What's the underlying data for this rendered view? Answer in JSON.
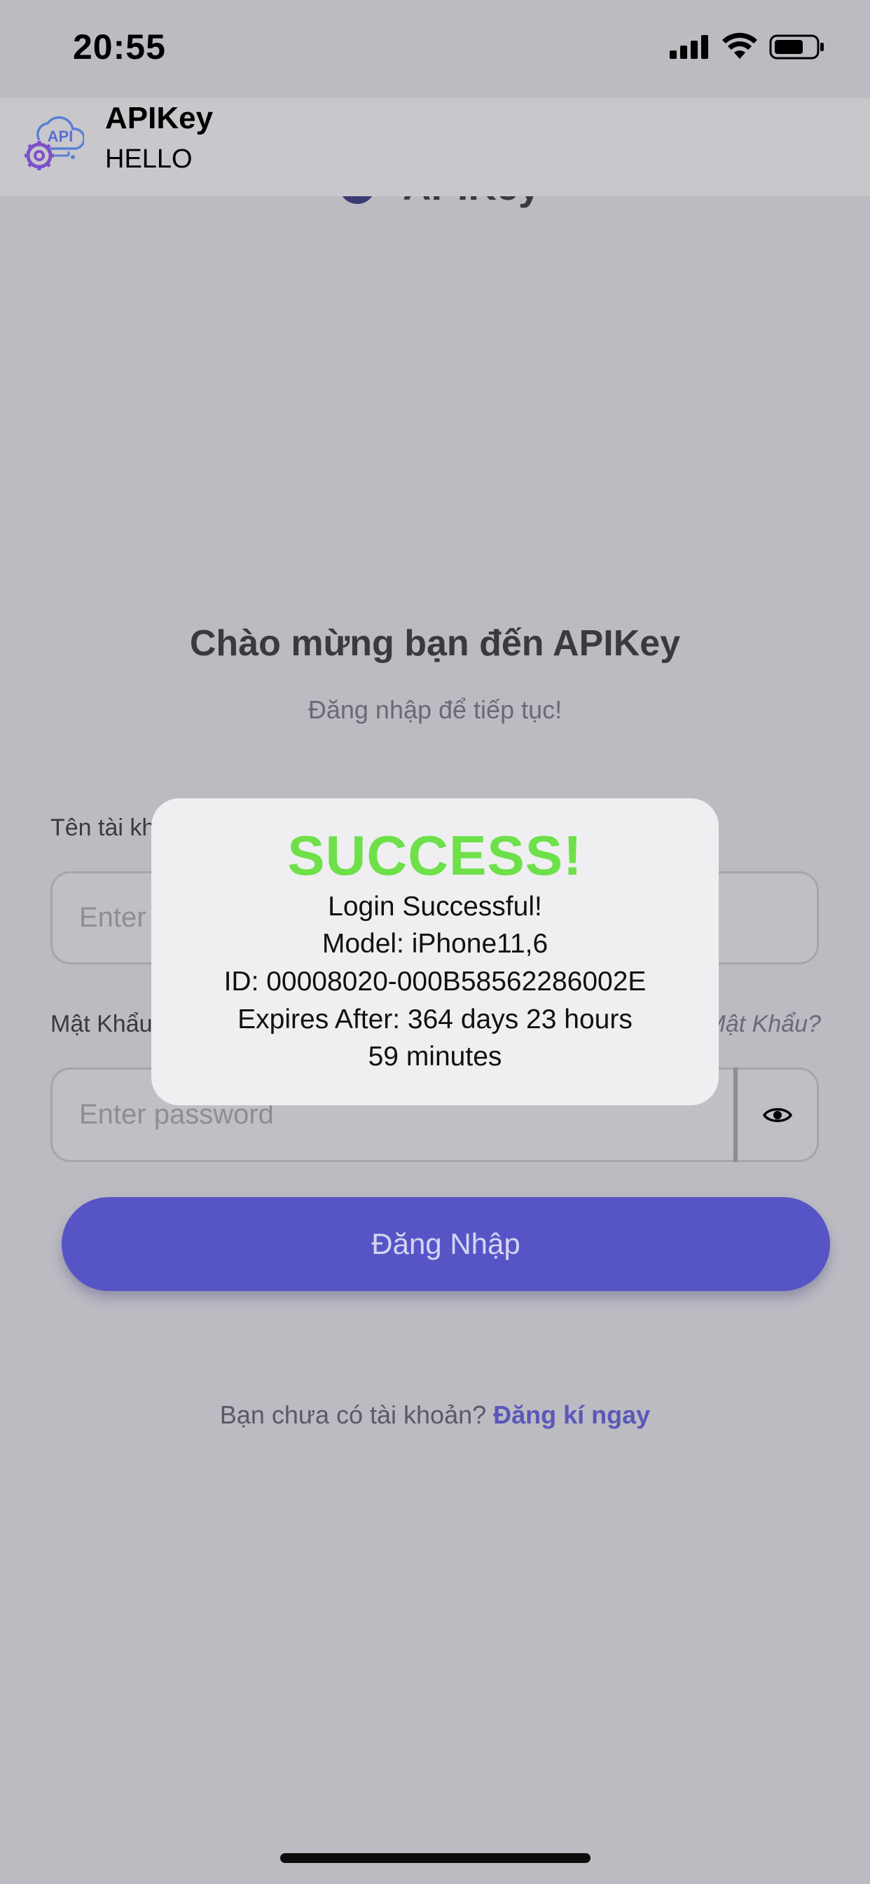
{
  "status_bar": {
    "time": "20:55"
  },
  "notification": {
    "app_name": "APIKey",
    "message": "HELLO",
    "icon_text": "API"
  },
  "login": {
    "welcome_title": "Chào mừng bạn đến APIKey",
    "subtitle": "Đăng nhập để tiếp tục!",
    "username_label": "Tên tài kh",
    "username_placeholder": "Enter",
    "password_label": "Mật Khẩu",
    "forgot_password": "Mật Khẩu?",
    "password_placeholder": "Enter password",
    "login_button": "Đăng Nhập",
    "signup_prompt": "Bạn chưa có tài khoản? ",
    "signup_link": "Đăng kí ngay"
  },
  "modal": {
    "title": "SUCCESS!",
    "line1": "Login Successful!",
    "line2": "Model: iPhone11,6",
    "line3": "ID: 00008020-000B58562286002E",
    "line4": "Expires After: 364 days 23 hours",
    "line5": "59 minutes",
    "title_color": "#6ee04a"
  },
  "colors": {
    "accent": "#5755c6",
    "background": "#bcbbc2"
  },
  "icons": [
    "signal-icon",
    "wifi-icon",
    "battery-icon",
    "api-gear-icon",
    "eye-icon"
  ]
}
